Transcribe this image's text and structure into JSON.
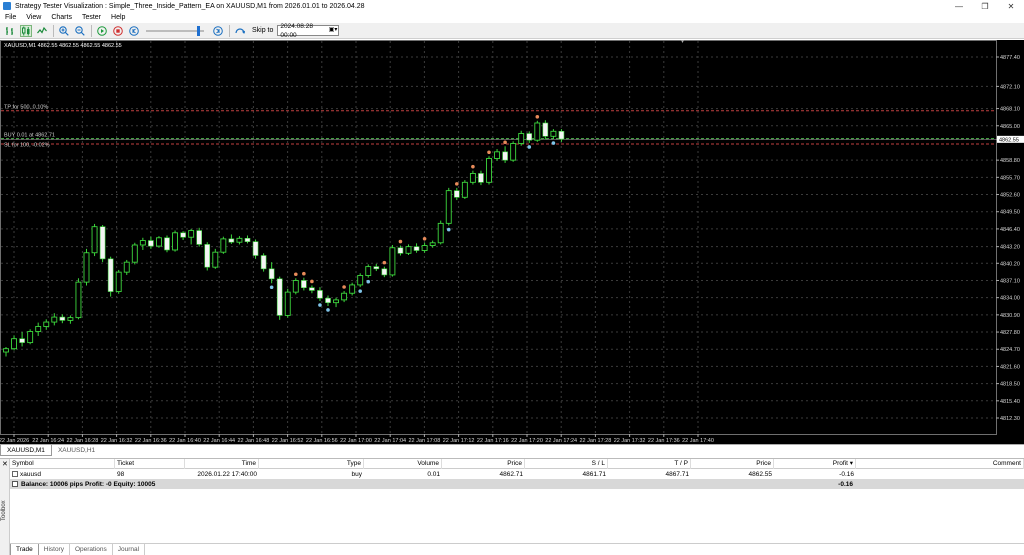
{
  "window": {
    "title": "Strategy Tester Visualization : Simple_Three_Inside_Pattern_EA on XAUUSD,M1 from 2026.01.01 to 2026.04.28",
    "minimize": "—",
    "maximize": "❐",
    "close": "✕"
  },
  "menu": [
    "File",
    "View",
    "Charts",
    "Tester",
    "Help"
  ],
  "toolbar": {
    "skip_label": "Skip to",
    "skip_value": "2024.08.28 00:00",
    "speed_fraction": 0.92
  },
  "chart": {
    "info": "XAUUSD,M1 4862.55 4862.55 4862.55 4862.55",
    "tp_label": "TP for 500, 0.10%",
    "buy_label": "BUY 0.01 at 4862.71",
    "sl_label": "SL for 100, -0.02%",
    "price_labels": [
      "4877.40",
      "4872.10",
      "4868.10",
      "4865.00",
      "4862.55",
      "4858.80",
      "4855.70",
      "4852.60",
      "4849.50",
      "4846.40",
      "4843.20",
      "4840.20",
      "4837.10",
      "4834.00",
      "4830.90",
      "4827.80",
      "4824.70",
      "4821.60",
      "4818.50",
      "4815.40",
      "4812.30"
    ],
    "time_labels": [
      "22 Jan 2026",
      "22 Jan 16:24",
      "22 Jan 16:28",
      "22 Jan 16:32",
      "22 Jan 16:36",
      "22 Jan 16:40",
      "22 Jan 16:44",
      "22 Jan 16:48",
      "22 Jan 16:52",
      "22 Jan 16:56",
      "22 Jan 17:00",
      "22 Jan 17:04",
      "22 Jan 17:08",
      "22 Jan 17:12",
      "22 Jan 17:16",
      "22 Jan 17:20",
      "22 Jan 17:24",
      "22 Jan 17:28",
      "22 Jan 17:32",
      "22 Jan 17:36",
      "22 Jan 17:40"
    ],
    "candles": [
      [
        4824.2,
        4825.1,
        4823.4,
        4824.8
      ],
      [
        4824.8,
        4827.2,
        4824.5,
        4826.6
      ],
      [
        4826.6,
        4827.8,
        4825.2,
        4825.9
      ],
      [
        4825.9,
        4828.3,
        4825.6,
        4827.9
      ],
      [
        4827.9,
        4829.5,
        4827.1,
        4828.8
      ],
      [
        4828.8,
        4830.1,
        4828.2,
        4829.6
      ],
      [
        4829.6,
        4831.2,
        4829.0,
        4830.5
      ],
      [
        4830.5,
        4831.0,
        4829.4,
        4829.9
      ],
      [
        4829.9,
        4830.8,
        4829.3,
        4830.4
      ],
      [
        4830.4,
        4837.5,
        4830.1,
        4836.8
      ],
      [
        4836.8,
        4842.8,
        4836.2,
        4842.1
      ],
      [
        4842.1,
        4847.3,
        4841.5,
        4846.8
      ],
      [
        4846.8,
        4847.1,
        4840.4,
        4841.0
      ],
      [
        4841.0,
        4841.4,
        4834.2,
        4835.1
      ],
      [
        4835.1,
        4839.0,
        4834.7,
        4838.6
      ],
      [
        4838.6,
        4840.8,
        4838.1,
        4840.4
      ],
      [
        4840.4,
        4843.9,
        4840.0,
        4843.5
      ],
      [
        4843.5,
        4844.8,
        4842.6,
        4844.3
      ],
      [
        4844.3,
        4845.0,
        4842.8,
        4843.3
      ],
      [
        4843.3,
        4845.1,
        4843.0,
        4844.8
      ],
      [
        4844.8,
        4845.2,
        4842.2,
        4842.6
      ],
      [
        4842.6,
        4846.1,
        4842.3,
        4845.7
      ],
      [
        4845.7,
        4846.0,
        4844.4,
        4844.9
      ],
      [
        4844.9,
        4846.4,
        4843.6,
        4846.1
      ],
      [
        4846.1,
        4846.6,
        4843.2,
        4843.6
      ],
      [
        4843.6,
        4844.0,
        4838.9,
        4839.5
      ],
      [
        4839.5,
        4842.8,
        4839.2,
        4842.2
      ],
      [
        4842.2,
        4845.0,
        4841.9,
        4844.6
      ],
      [
        4844.6,
        4845.4,
        4843.7,
        4844.0
      ],
      [
        4844.0,
        4845.1,
        4843.6,
        4844.7
      ],
      [
        4844.7,
        4845.2,
        4843.8,
        4844.1
      ],
      [
        4844.1,
        4844.5,
        4841.0,
        4841.6
      ],
      [
        4841.6,
        4842.0,
        4838.7,
        4839.2
      ],
      [
        4839.2,
        4840.4,
        4836.6,
        4837.4
      ],
      [
        4837.4,
        4837.8,
        4830.0,
        4830.8
      ],
      [
        4830.8,
        4835.6,
        4830.4,
        4835.0
      ],
      [
        4835.0,
        4837.5,
        4834.6,
        4837.1
      ],
      [
        4837.1,
        4837.6,
        4835.3,
        4835.8
      ],
      [
        4835.8,
        4836.2,
        4834.8,
        4835.3
      ],
      [
        4835.3,
        4835.9,
        4833.4,
        4833.9
      ],
      [
        4833.9,
        4834.4,
        4832.5,
        4833.1
      ],
      [
        4833.1,
        4834.0,
        4832.3,
        4833.6
      ],
      [
        4833.6,
        4835.2,
        4833.2,
        4834.8
      ],
      [
        4834.8,
        4836.7,
        4834.4,
        4836.3
      ],
      [
        4836.3,
        4838.4,
        4835.9,
        4838.0
      ],
      [
        4838.0,
        4840.0,
        4837.6,
        4839.6
      ],
      [
        4839.6,
        4840.1,
        4838.8,
        4839.2
      ],
      [
        4839.2,
        4839.6,
        4837.7,
        4838.1
      ],
      [
        4838.1,
        4843.5,
        4837.8,
        4843.0
      ],
      [
        4843.0,
        4843.4,
        4841.6,
        4842.0
      ],
      [
        4842.0,
        4843.6,
        4841.7,
        4843.2
      ],
      [
        4843.2,
        4843.8,
        4842.1,
        4842.5
      ],
      [
        4842.5,
        4843.9,
        4842.1,
        4843.4
      ],
      [
        4843.4,
        4844.3,
        4843.0,
        4843.9
      ],
      [
        4843.9,
        4847.9,
        4843.6,
        4847.4
      ],
      [
        4847.4,
        4853.8,
        4847.0,
        4853.3
      ],
      [
        4853.3,
        4853.8,
        4851.6,
        4852.1
      ],
      [
        4852.1,
        4855.2,
        4851.8,
        4854.8
      ],
      [
        4854.8,
        4856.9,
        4854.4,
        4856.4
      ],
      [
        4856.4,
        4856.9,
        4854.3,
        4854.8
      ],
      [
        4854.8,
        4859.5,
        4854.4,
        4859.1
      ],
      [
        4859.1,
        4860.8,
        4858.7,
        4860.3
      ],
      [
        4860.3,
        4861.3,
        4858.3,
        4858.8
      ],
      [
        4858.8,
        4862.2,
        4858.5,
        4861.8
      ],
      [
        4861.8,
        4864.1,
        4861.4,
        4863.6
      ],
      [
        4863.6,
        4864.0,
        4861.9,
        4862.4
      ],
      [
        4862.4,
        4865.9,
        4862.1,
        4865.5
      ],
      [
        4865.5,
        4866.0,
        4862.5,
        4863.1
      ],
      [
        4863.1,
        4864.4,
        4862.6,
        4864.0
      ],
      [
        4864.0,
        4864.4,
        4862.1,
        4862.6
      ]
    ]
  },
  "chart_tabs": [
    "XAUUSD,M1",
    "XAUUSD,H1"
  ],
  "terminal": {
    "side_label": "Toolbox",
    "columns": [
      "Symbol",
      "Ticket",
      "Time",
      "Type",
      "Volume",
      "Price",
      "S / L",
      "T / P",
      "Price",
      "Profit",
      "Comment"
    ],
    "profit_sort_icon": "▾",
    "rows": [
      {
        "symbol": "xauusd",
        "ticket": "98",
        "time": "2026.01.22 17:40:00",
        "type": "buy",
        "volume": "0.01",
        "price": "4862.71",
        "sl": "4861.71",
        "tp": "4867.71",
        "price2": "4862.55",
        "profit": "-0.16",
        "comment": ""
      }
    ],
    "balance_text": "Balance: 10006 pips   Profit: -0   Equity: 10005",
    "balance_profit": "-0.16",
    "tabs": [
      "Trade",
      "History",
      "Operations",
      "Journal"
    ]
  }
}
